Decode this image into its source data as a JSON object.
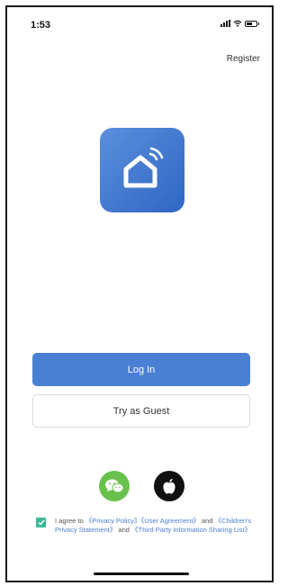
{
  "status_bar": {
    "time": "1:53"
  },
  "header": {
    "register_label": "Register"
  },
  "actions": {
    "login_label": "Log In",
    "guest_label": "Try as Guest"
  },
  "social": {
    "wechat_icon": "wechat-icon",
    "apple_icon": "apple-icon"
  },
  "agreement": {
    "checked": true,
    "prefix": "I agree to ",
    "privacy_policy": "《Privacy Policy》",
    "user_agreement": "《User Agreement》",
    "and_1": " and ",
    "childrens_privacy": "《Children's Privacy Statement》",
    "and_2": " and ",
    "third_party": "《Third Party Information Sharing List》"
  },
  "colors": {
    "primary": "#4a7fd4",
    "wechat": "#69c14d",
    "checkbox": "#3cb89a"
  }
}
